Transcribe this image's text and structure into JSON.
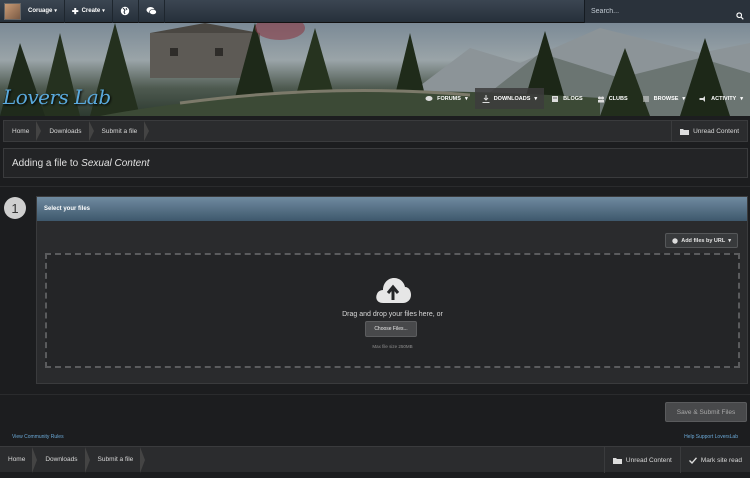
{
  "topbar": {
    "user_name": "Coruage",
    "create_label": "Create",
    "search_placeholder": "Search...",
    "icons": [
      "avatar",
      "globe-icon",
      "chat-icon",
      "search-icon"
    ]
  },
  "banner": {
    "logo_text": "Lovers Lab",
    "nav": [
      {
        "label": "FORUMS",
        "icon": "forums-icon",
        "caret": true
      },
      {
        "label": "DOWNLOADS",
        "icon": "download-icon",
        "caret": true
      },
      {
        "label": "BLOGS",
        "icon": "blogs-icon",
        "caret": false
      },
      {
        "label": "CLUBS",
        "icon": "clubs-icon",
        "caret": false
      },
      {
        "label": "BROWSE",
        "icon": "browse-icon",
        "caret": true
      },
      {
        "label": "ACTIVITY",
        "icon": "activity-icon",
        "caret": true
      }
    ]
  },
  "breadcrumb": {
    "items": [
      "Home",
      "Downloads",
      "Submit a file"
    ],
    "unread_label": "Unread Content"
  },
  "title": {
    "prefix": "Adding a file to",
    "category": "Sexual Content"
  },
  "step": {
    "number": "1",
    "heading": "Select your files",
    "add_url_label": "Add files by URL",
    "drop_text": "Drag and drop your files here, or",
    "choose_label": "Choose Files...",
    "max_size": "Max file size 250MB"
  },
  "actions": {
    "save_label": "Save & Submit Files"
  },
  "footer": {
    "left_link": "View Community Rules",
    "right_link": "Help Support LoversLab",
    "breadcrumb": [
      "Home",
      "Downloads",
      "Submit a file"
    ],
    "unread_label": "Unread Content",
    "mark_read_label": "Mark site read"
  },
  "colors": {
    "accent": "#5aa9dc",
    "header_gradient_top": "#6f8aa0",
    "page_bg": "#1c1d1f"
  }
}
